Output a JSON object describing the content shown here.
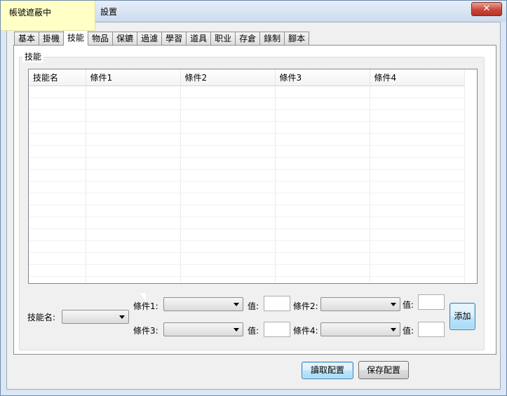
{
  "status_overlay": "帳號遮蔽中",
  "window": {
    "title": "設置",
    "close_symbol": "✕"
  },
  "tabs": [
    {
      "label": "基本"
    },
    {
      "label": "掛機"
    },
    {
      "label": "技能"
    },
    {
      "label": "物品"
    },
    {
      "label": "保鑣"
    },
    {
      "label": "過濾"
    },
    {
      "label": "學習"
    },
    {
      "label": "道具"
    },
    {
      "label": "职业"
    },
    {
      "label": "存倉"
    },
    {
      "label": "錄制"
    },
    {
      "label": "腳本"
    }
  ],
  "active_tab": "技能",
  "skill_group": {
    "title": "技能",
    "table": {
      "columns": [
        "技能名",
        "條件1",
        "條件2",
        "條件3",
        "條件4"
      ],
      "rows": []
    }
  },
  "editor": {
    "skill_label": "技能名:",
    "cond1_label": "條件1:",
    "cond2_label": "條件2:",
    "cond3_label": "條件3:",
    "cond4_label": "條件4:",
    "value_label": "值:",
    "add_button": "添加"
  },
  "footer": {
    "load_button": "讀取配置",
    "save_button": "保存配置"
  },
  "icons": {
    "close": "close-icon",
    "dropdown": "chevron-down-icon",
    "cursor": "mouse-cursor-icon"
  }
}
